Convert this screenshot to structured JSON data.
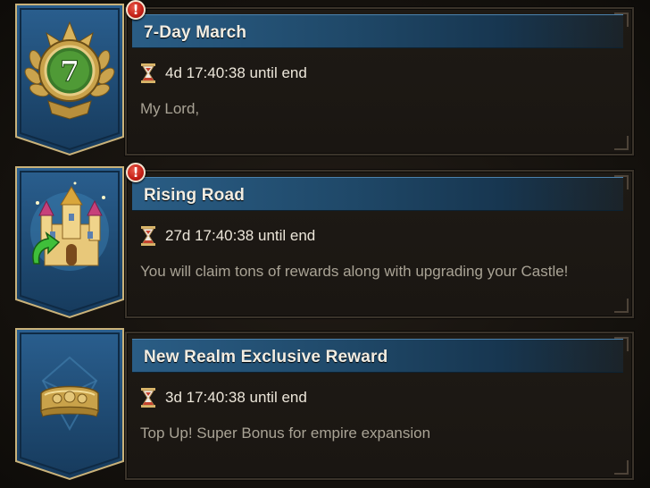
{
  "events": [
    {
      "title": "7-Day March",
      "timer": "4d 17:40:38 until end",
      "description": "My Lord,",
      "badge_number": "7",
      "alert": "!",
      "icon": "laurel-medal-icon"
    },
    {
      "title": "Rising Road",
      "timer": "27d 17:40:38 until end",
      "description": "You will claim tons of rewards along with upgrading your Castle!",
      "alert": "!",
      "icon": "castle-upgrade-icon"
    },
    {
      "title": "New Realm Exclusive Reward",
      "timer": "3d 17:40:38 until end",
      "description": "Top Up! Super Bonus for empire expansion",
      "icon": "golden-crown-icon"
    }
  ],
  "colors": {
    "title_bar": "#1f4868",
    "banner_blue": "#1d4a73",
    "gold": "#c9a24a",
    "alert_red": "#c41f16"
  }
}
